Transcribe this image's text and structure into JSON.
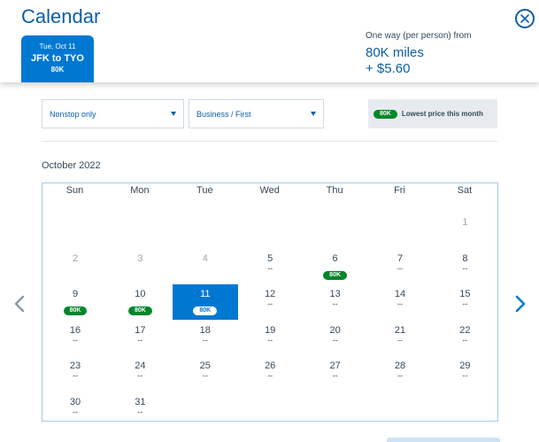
{
  "header": {
    "title": "Calendar",
    "trip": {
      "date": "Tue, Oct 11",
      "route": "JFK to TYO",
      "price": "80K"
    },
    "fare": {
      "caption": "One way (per person) from",
      "miles": "80K miles",
      "tax": "+ $5.60"
    }
  },
  "filters": {
    "stops": "Nonstop only",
    "cabin": "Business / First",
    "legend": {
      "pill": "80K",
      "text": "Lowest price this month"
    }
  },
  "calendar": {
    "month": "October 2022",
    "weekdays": [
      "Sun",
      "Mon",
      "Tue",
      "Wed",
      "Thu",
      "Fri",
      "Sat"
    ],
    "first_weekday_index": 6,
    "selected_day": 11,
    "days": [
      {
        "day": "1",
        "price": "",
        "past": true
      },
      {
        "day": "2",
        "price": "",
        "past": true
      },
      {
        "day": "3",
        "price": "",
        "past": true
      },
      {
        "day": "4",
        "price": "",
        "past": true
      },
      {
        "day": "5",
        "price": "--",
        "past": false
      },
      {
        "day": "6",
        "price": "80K",
        "past": false
      },
      {
        "day": "7",
        "price": "--",
        "past": false
      },
      {
        "day": "8",
        "price": "--",
        "past": false
      },
      {
        "day": "9",
        "price": "80K",
        "past": false
      },
      {
        "day": "10",
        "price": "80K",
        "past": false
      },
      {
        "day": "11",
        "price": "80K",
        "past": false
      },
      {
        "day": "12",
        "price": "--",
        "past": false
      },
      {
        "day": "13",
        "price": "--",
        "past": false
      },
      {
        "day": "14",
        "price": "--",
        "past": false
      },
      {
        "day": "15",
        "price": "--",
        "past": false
      },
      {
        "day": "16",
        "price": "--",
        "past": false
      },
      {
        "day": "17",
        "price": "--",
        "past": false
      },
      {
        "day": "18",
        "price": "--",
        "past": false
      },
      {
        "day": "19",
        "price": "--",
        "past": false
      },
      {
        "day": "20",
        "price": "--",
        "past": false
      },
      {
        "day": "21",
        "price": "--",
        "past": false
      },
      {
        "day": "22",
        "price": "--",
        "past": false
      },
      {
        "day": "23",
        "price": "--",
        "past": false
      },
      {
        "day": "24",
        "price": "--",
        "past": false
      },
      {
        "day": "25",
        "price": "--",
        "past": false
      },
      {
        "day": "26",
        "price": "--",
        "past": false
      },
      {
        "day": "27",
        "price": "--",
        "past": false
      },
      {
        "day": "28",
        "price": "--",
        "past": false
      },
      {
        "day": "29",
        "price": "--",
        "past": false
      },
      {
        "day": "30",
        "price": "--",
        "past": false
      },
      {
        "day": "31",
        "price": "--",
        "past": false
      }
    ]
  },
  "colors": {
    "primary": "#0078d2",
    "title_blue": "#0b5fa5",
    "lowest_price_green": "#00862b",
    "text": "#36495a"
  },
  "icons": {
    "close": "close-icon",
    "prev": "chevron-left-icon",
    "next": "chevron-right-icon",
    "dropdown": "caret-down-icon"
  }
}
